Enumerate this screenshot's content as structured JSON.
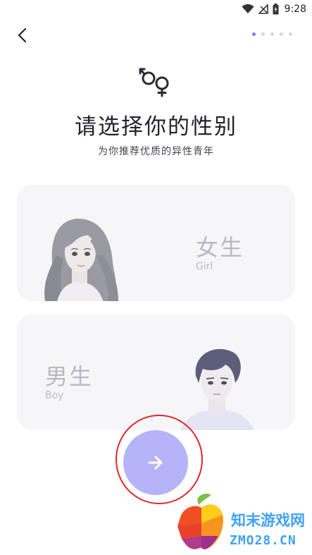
{
  "status_bar": {
    "time": "9:28",
    "icons": [
      "wifi-icon",
      "signal-icon",
      "battery-icon"
    ]
  },
  "header": {
    "back_icon": "chevron-left-icon",
    "steps_total": 5,
    "steps_current": 1
  },
  "title": "请选择你的性别",
  "subtitle": "为你推荐优质的异性青年",
  "options": {
    "female": {
      "label": "女生",
      "sub": "Girl"
    },
    "male": {
      "label": "男生",
      "sub": "Boy"
    }
  },
  "next_button": {
    "icon": "arrow-right-icon"
  },
  "watermark": {
    "cn": "知末游戏网",
    "en": "ZMO28.CN"
  },
  "colors": {
    "accent": "#7b7ff0",
    "next_button": "#b5b4f8",
    "card_bg": "#f6f6f8",
    "highlight_ring": "#e3262b",
    "watermark": "#41a1f5"
  }
}
